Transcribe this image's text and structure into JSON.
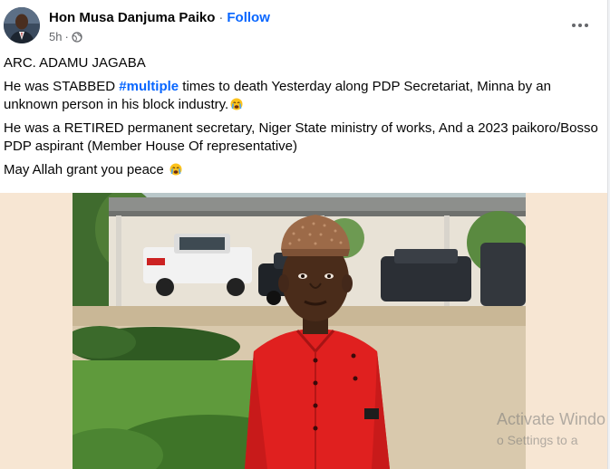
{
  "post": {
    "author": "Hon Musa Danjuma Paiko",
    "separator": "·",
    "follow_label": "Follow",
    "time": "5h",
    "privacy_icon": "globe-icon",
    "more_icon": "more-options-icon",
    "paragraphs": {
      "p1": "ARC. ADAMU JAGABA",
      "p2_before": "He was STABBED ",
      "p2_hashtag": "#multiple",
      "p2_after": " times to death Yesterday along PDP Secretariat, Minna by an unknown person in his block industry.",
      "p3": "He was a RETIRED permanent secretary, Niger State ministry of works, And a 2023 paikoro/Bosso PDP aspirant (Member House Of representative)",
      "p4": "May Allah grant you peace"
    },
    "emoji_icon": "crying-face-emoji"
  },
  "watermark": {
    "line1": "Activate Windo",
    "line2": "o Settings to a"
  },
  "colors": {
    "link_blue": "#0866ff",
    "secondary_text": "#65676b",
    "media_background": "#f7e6d3"
  }
}
